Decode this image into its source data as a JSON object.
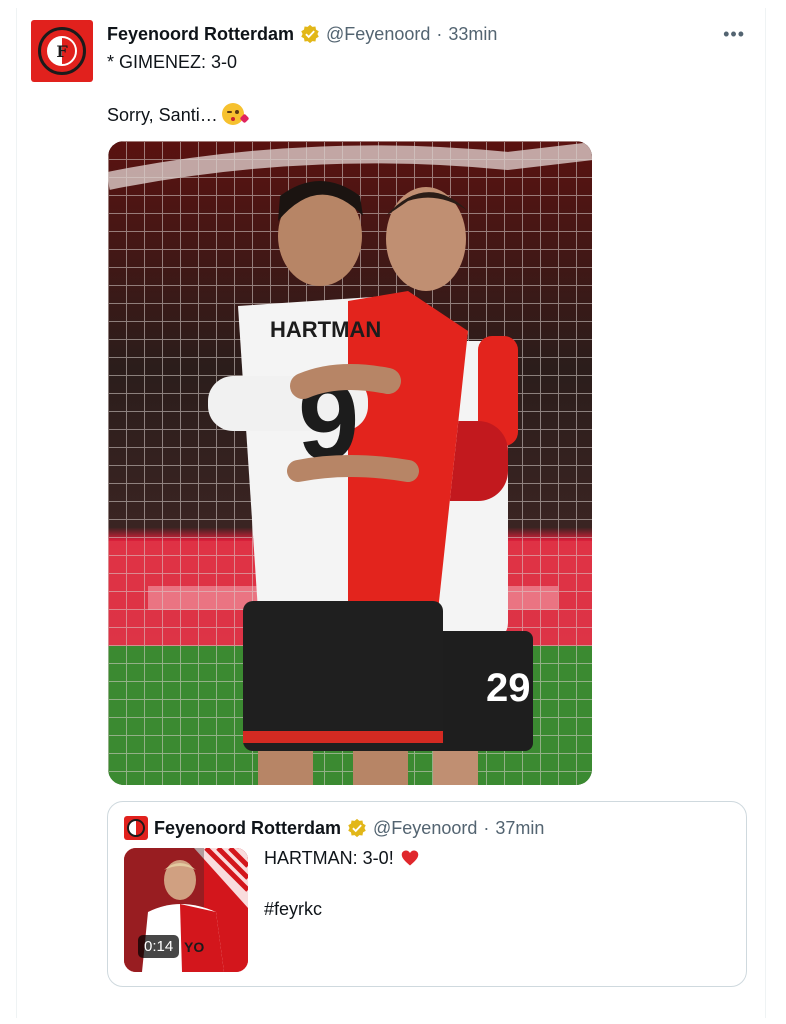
{
  "tweet": {
    "author_name": "Feyenoord Rotterdam",
    "author_handle": "@Feyenoord",
    "separator": "·",
    "time": "33min",
    "more_icon": "more-horizontal-icon",
    "line1": "* GIMENEZ: 3-0",
    "line2": "Sorry, Santi…",
    "emoji": "kissing-face-emoji",
    "photo_label": "HARTMAN",
    "photo_numbers": [
      "9",
      "29"
    ]
  },
  "quoted": {
    "author_name": "Feyenoord Rotterdam",
    "author_handle": "@Feyenoord",
    "separator": "·",
    "time": "37min",
    "text": "HARTMAN: 3-0!",
    "hashtag": "#feyrkc",
    "video_duration": "0:14"
  },
  "colors": {
    "brand_red": "#e1211d",
    "verified_gold": "#e2b719",
    "muted": "#536471",
    "border": "#cfd9de"
  }
}
